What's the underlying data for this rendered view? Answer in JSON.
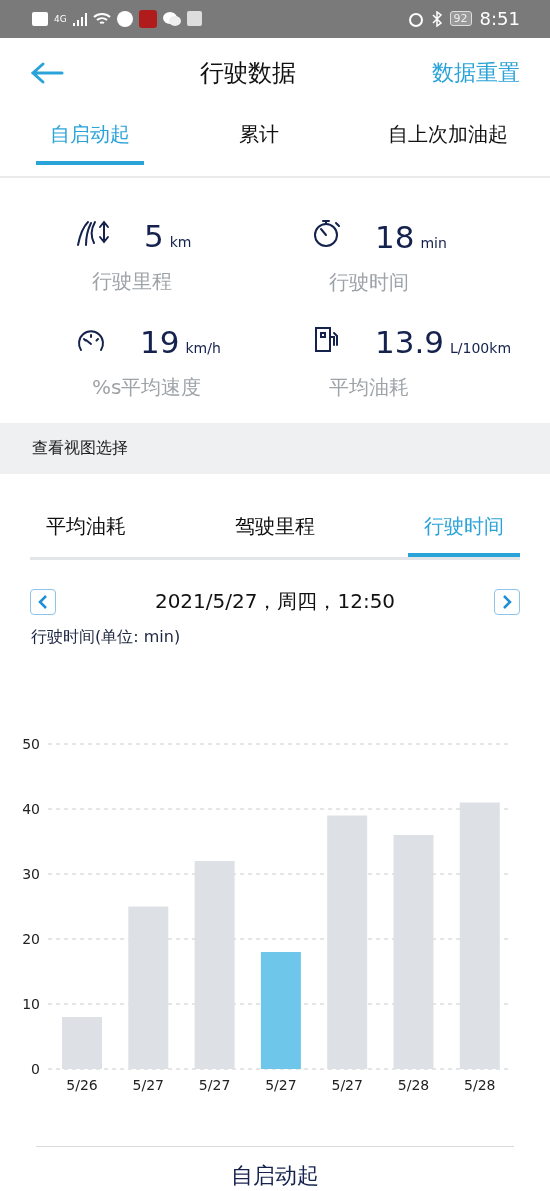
{
  "status_bar": {
    "network": "4G",
    "battery": "92",
    "time": "8:51"
  },
  "header": {
    "title": "行驶数据",
    "action": "数据重置"
  },
  "tabs": [
    {
      "label": "自启动起",
      "selected": true
    },
    {
      "label": "累计",
      "selected": false
    },
    {
      "label": "自上次加油起",
      "selected": false
    }
  ],
  "stats": [
    {
      "kind": "distance",
      "value": "5",
      "unit": "km",
      "label": "行驶里程"
    },
    {
      "kind": "time",
      "value": "18",
      "unit": "min",
      "label": "行驶时间"
    },
    {
      "kind": "speed",
      "value": "19",
      "unit": "km/h",
      "label": "%s平均速度"
    },
    {
      "kind": "fuel",
      "value": "13.9",
      "unit": "L/100km",
      "label": "平均油耗"
    }
  ],
  "view_section": {
    "title": "查看视图选择"
  },
  "chart_tabs": [
    {
      "label": "平均油耗",
      "selected": false
    },
    {
      "label": "驾驶里程",
      "selected": false
    },
    {
      "label": "行驶时间",
      "selected": true
    }
  ],
  "date_nav": {
    "date": "2021/5/27，周四，12:50"
  },
  "chart": {
    "unit_label": "行驶时间(单位: min)",
    "chart_data": {
      "type": "bar",
      "categories": [
        "5/26",
        "5/27",
        "5/27",
        "5/27",
        "5/27",
        "5/28",
        "5/28"
      ],
      "series": [
        {
          "color": "#dde1e5",
          "values": [
            8,
            25,
            32,
            null,
            39,
            36,
            41
          ]
        },
        {
          "color": "#6ec6ea",
          "values": [
            null,
            null,
            null,
            18,
            null,
            null,
            null
          ]
        }
      ],
      "ylim": [
        0,
        50
      ],
      "yticks": [
        0,
        10,
        20,
        30,
        40,
        50
      ],
      "grid": true
    }
  },
  "footer": {
    "label": "自启动起"
  }
}
